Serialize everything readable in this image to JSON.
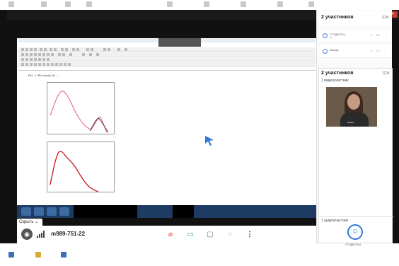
{
  "meeting": {
    "hide_label": "Скрыть ⌄",
    "meeting_id": "m989-751-22"
  },
  "panel_top": {
    "title": "2 участников",
    "participants": [
      {
        "name": "СТУДЕНТЫ",
        "sub": "Вы"
      },
      {
        "name": "Nastya",
        "sub": ""
      }
    ]
  },
  "panel_main": {
    "title": "2 участников",
    "video_count": "1 видеоучастник",
    "video_name": "Nastya",
    "audio_count": "1 аудиоучастник",
    "audio_name": "СТУДЕНТЫ"
  },
  "maple": {
    "formula_label": "f(t) := Pb (dom) (t) ..."
  },
  "icons": [
    "windows-icon",
    "minimize-icon",
    "maximize-icon",
    "close-icon",
    "mic-muted-icon",
    "camera-icon",
    "screen-share-icon",
    "chat-icon",
    "more-icon",
    "user-icon",
    "signal-icon"
  ],
  "colors": {
    "accent": "#2f7bd6",
    "mic_muted": "#e0403a",
    "camera_on": "#2ba84a",
    "plot_red": "#cc2222",
    "plot_pink": "#e37a86"
  }
}
